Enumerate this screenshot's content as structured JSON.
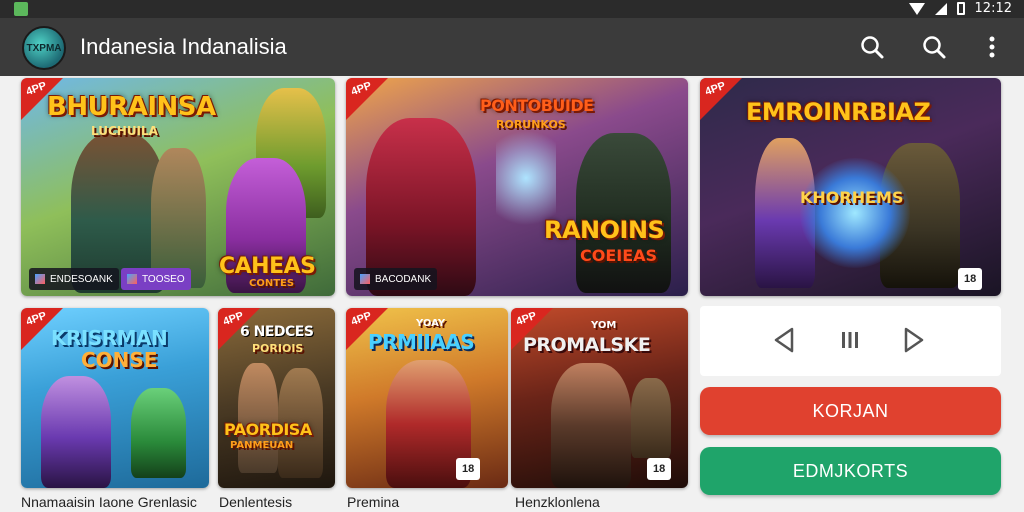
{
  "status_bar": {
    "time": "12:12"
  },
  "app_bar": {
    "logo_text": "TXPMA",
    "title": "Indanesia Indanalisia"
  },
  "colors": {
    "app_bar": "#3b3b3b",
    "corner_ribbon": "#d9261f",
    "primary_button": "#e0412f",
    "secondary_button": "#1fa46a"
  },
  "featured": [
    {
      "corner": "4PP",
      "title": "BHURAINSA",
      "subtitle": "LUCHUILA",
      "art_sub": "CAHEAS",
      "art_sub2": "CONTES",
      "badges": [
        "ENDESOANK",
        "TOOSEO"
      ]
    },
    {
      "corner": "4PP",
      "title": "PONTOBUIDE",
      "subtitle": "RORUNKOS",
      "art_sub": "RANOINS",
      "art_sub2": "COEIEAS",
      "badges": [
        "BACODANK"
      ]
    },
    {
      "corner": "4PP",
      "title": "EMROINRBIAZ",
      "subtitle": "KHORHEMS",
      "badges": [
        "18"
      ]
    }
  ],
  "grid": [
    {
      "corner": "4PP",
      "title": "KRISRMAN",
      "subtitle": "CONSE",
      "caption": "Nnamaaisin Iaone Grenlasic"
    },
    {
      "corner": "4PP",
      "title": "6 NEDCES",
      "subtitle": "PORIOIS",
      "art_sub": "PAORDISA",
      "art_sub2": "PANMEUAN",
      "caption": "Denlentesis"
    },
    {
      "corner": "4PP",
      "title": "PRMIIAAS",
      "subtitle": "YOAY",
      "badges": [
        "18"
      ],
      "caption": "Premina"
    },
    {
      "corner": "4PP",
      "title": "PROMALSKE",
      "subtitle": "YOM",
      "badges": [
        "18"
      ],
      "caption": "Henzklonlena"
    }
  ],
  "player": {
    "prev_icon": "prev-icon",
    "pause_icon": "pause-icon",
    "next_icon": "next-icon"
  },
  "buttons": {
    "primary_label": "KORJAN",
    "secondary_label": "EDMJKORTS"
  }
}
